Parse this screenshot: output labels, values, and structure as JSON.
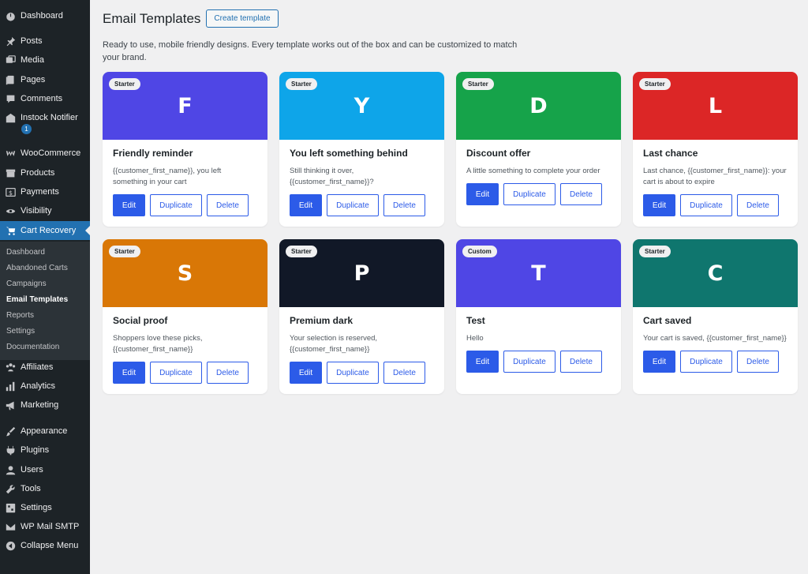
{
  "sidebar": {
    "items": [
      {
        "label": "Dashboard",
        "icon": "dashboard-icon"
      },
      {
        "label": "Posts",
        "icon": "pin-icon"
      },
      {
        "label": "Media",
        "icon": "media-icon"
      },
      {
        "label": "Pages",
        "icon": "pages-icon"
      },
      {
        "label": "Comments",
        "icon": "comment-icon"
      },
      {
        "label": "Instock Notifier",
        "icon": "store-icon"
      },
      {
        "label": "WooCommerce",
        "icon": "woo-icon"
      },
      {
        "label": "Products",
        "icon": "archive-icon"
      },
      {
        "label": "Payments",
        "icon": "dollar-icon"
      },
      {
        "label": "Visibility",
        "icon": "eye-icon"
      },
      {
        "label": "Cart Recovery",
        "icon": "cart-icon"
      },
      {
        "label": "Affiliates",
        "icon": "groups-icon"
      },
      {
        "label": "Analytics",
        "icon": "chart-icon"
      },
      {
        "label": "Marketing",
        "icon": "megaphone-icon"
      },
      {
        "label": "Appearance",
        "icon": "brush-icon"
      },
      {
        "label": "Plugins",
        "icon": "plugin-icon"
      },
      {
        "label": "Users",
        "icon": "user-icon"
      },
      {
        "label": "Tools",
        "icon": "wrench-icon"
      },
      {
        "label": "Settings",
        "icon": "settings-icon"
      },
      {
        "label": "WP Mail SMTP",
        "icon": "mail-icon"
      },
      {
        "label": "Collapse Menu",
        "icon": "collapse-icon"
      }
    ],
    "notifier_badge": "1",
    "submenu": [
      "Dashboard",
      "Abandoned Carts",
      "Campaigns",
      "Email Templates",
      "Reports",
      "Settings",
      "Documentation"
    ]
  },
  "page": {
    "title": "Email Templates",
    "create_label": "Create template",
    "intro": "Ready to use, mobile friendly designs. Every template works out of the box and can be customized to match your brand."
  },
  "buttons": {
    "edit": "Edit",
    "duplicate": "Duplicate",
    "delete": "Delete"
  },
  "templates": [
    {
      "badge": "Starter",
      "letter": "F",
      "color": "#4f46e5",
      "title": "Friendly reminder",
      "desc": "{{customer_first_name}}, you left something in your cart"
    },
    {
      "badge": "Starter",
      "letter": "Y",
      "color": "#0ea5e9",
      "title": "You left something behind",
      "desc": "Still thinking it over, {{customer_first_name}}?"
    },
    {
      "badge": "Starter",
      "letter": "D",
      "color": "#16a34a",
      "title": "Discount offer",
      "desc": "A little something to complete your order"
    },
    {
      "badge": "Starter",
      "letter": "L",
      "color": "#dc2626",
      "title": "Last chance",
      "desc": "Last chance, {{customer_first_name}}: your cart is about to expire"
    },
    {
      "badge": "Starter",
      "letter": "S",
      "color": "#d97706",
      "title": "Social proof",
      "desc": "Shoppers love these picks, {{customer_first_name}}"
    },
    {
      "badge": "Starter",
      "letter": "P",
      "color": "#111827",
      "title": "Premium dark",
      "desc": "Your selection is reserved, {{customer_first_name}}"
    },
    {
      "badge": "Custom",
      "letter": "T",
      "color": "#4f46e5",
      "title": "Test",
      "desc": "Hello"
    },
    {
      "badge": "Starter",
      "letter": "C",
      "color": "#0f766e",
      "title": "Cart saved",
      "desc": "Your cart is saved, {{customer_first_name}}"
    }
  ]
}
